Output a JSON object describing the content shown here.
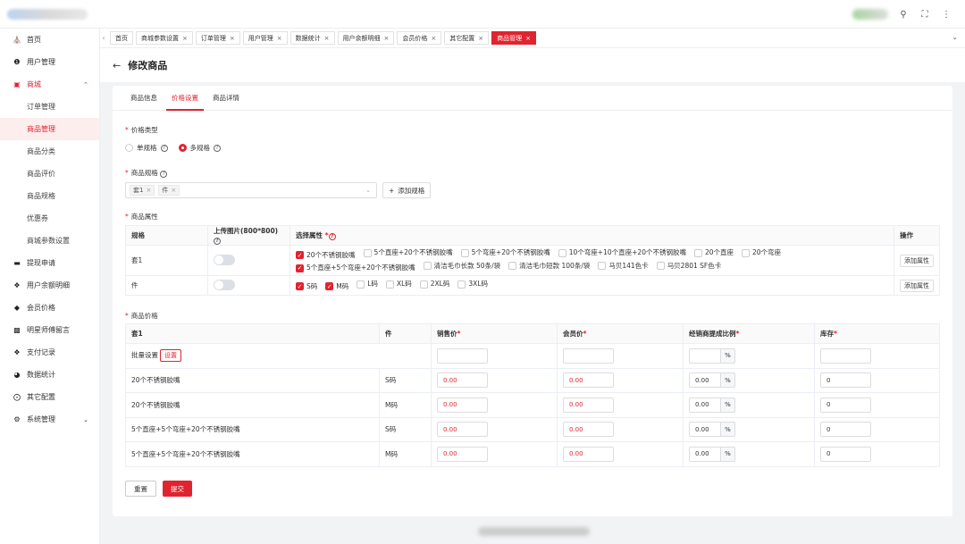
{
  "sidebar": {
    "items": [
      {
        "label": "首页",
        "icon": "home-icon"
      },
      {
        "label": "用户管理",
        "icon": "user-icon"
      },
      {
        "label": "商城",
        "icon": "shop-icon"
      }
    ],
    "mall_subitems": [
      "订单管理",
      "商品管理",
      "商品分类",
      "商品评价",
      "商品规格",
      "优惠券",
      "商城参数设置"
    ],
    "bottom_items": [
      {
        "label": "提现申请",
        "icon": "card-icon"
      },
      {
        "label": "用户余额明细",
        "icon": "balance-icon"
      },
      {
        "label": "会员价格",
        "icon": "diamond-icon"
      },
      {
        "label": "明星师傅留言",
        "icon": "message-icon"
      },
      {
        "label": "支付记录",
        "icon": "pay-icon"
      },
      {
        "label": "数据统计",
        "icon": "chart-icon"
      },
      {
        "label": "其它配置",
        "icon": "config-icon"
      },
      {
        "label": "系统管理",
        "icon": "gear-icon"
      }
    ]
  },
  "tabs": [
    "首页",
    "商城参数设置",
    "订单管理",
    "用户管理",
    "数据统计",
    "用户余额明细",
    "会员价格",
    "其它配置",
    "商品管理"
  ],
  "page": {
    "title": "修改商品"
  },
  "subtabs": [
    "商品信息",
    "价格设置",
    "商品详情"
  ],
  "form": {
    "price_type_label": "价格类型",
    "single_spec": "单规格",
    "multi_spec": "多规格",
    "spec_label": "商品规格",
    "spec_tags": [
      "套1",
      "件"
    ],
    "add_spec": "添加规格",
    "attr_label": "商品属性",
    "price_label": "商品价格"
  },
  "attr_table": {
    "headers": [
      "规格",
      "上传图片(800*800)",
      "选择属性",
      "操作"
    ],
    "rows": [
      {
        "name": "套1",
        "line1": [
          {
            "t": "20个不锈钢胶嘴",
            "on": true
          },
          {
            "t": "5个直座+20个不锈钢胶嘴",
            "on": false
          },
          {
            "t": "5个弯座+20个不锈钢胶嘴",
            "on": false
          },
          {
            "t": "10个弯座+10个直座+20个不锈钢胶嘴",
            "on": false
          },
          {
            "t": "20个直座",
            "on": false
          },
          {
            "t": "20个弯座",
            "on": false
          }
        ],
        "line2": [
          {
            "t": "5个直座+5个弯座+20个不锈钢胶嘴",
            "on": true
          },
          {
            "t": "清洁毛巾长款 50条/袋",
            "on": false
          },
          {
            "t": "清洁毛巾短款 100条/袋",
            "on": false
          },
          {
            "t": "马贝141色卡",
            "on": false
          },
          {
            "t": "马贝2801 SF色卡",
            "on": false
          }
        ],
        "op": "添加属性"
      },
      {
        "name": "件",
        "line1": [
          {
            "t": "S码",
            "on": true
          },
          {
            "t": "M码",
            "on": true
          },
          {
            "t": "L码",
            "on": false
          },
          {
            "t": "XL码",
            "on": false
          },
          {
            "t": "2XL码",
            "on": false
          },
          {
            "t": "3XL码",
            "on": false
          }
        ],
        "line2": [],
        "op": "添加属性"
      }
    ]
  },
  "price_table": {
    "headers": [
      "套1",
      "件",
      "销售价",
      "会员价",
      "经销商提成比例",
      "库存"
    ],
    "batch_label": "批量设置",
    "batch_btn": "设置",
    "pct": "%",
    "rows": [
      {
        "a": "20个不锈钢胶嘴",
        "b": "S码",
        "sale": "0.00",
        "member": "0.00",
        "ratio": "0.00",
        "stock": "0"
      },
      {
        "a": "20个不锈钢胶嘴",
        "b": "M码",
        "sale": "0.00",
        "member": "0.00",
        "ratio": "0.00",
        "stock": "0"
      },
      {
        "a": "5个直座+5个弯座+20个不锈钢胶嘴",
        "b": "S码",
        "sale": "0.00",
        "member": "0.00",
        "ratio": "0.00",
        "stock": "0"
      },
      {
        "a": "5个直座+5个弯座+20个不锈钢胶嘴",
        "b": "M码",
        "sale": "0.00",
        "member": "0.00",
        "ratio": "0.00",
        "stock": "0"
      }
    ]
  },
  "buttons": {
    "reset": "重置",
    "submit": "提交"
  },
  "colors": {
    "accent": "#e0242f"
  }
}
